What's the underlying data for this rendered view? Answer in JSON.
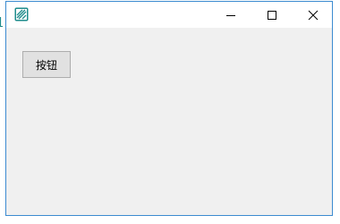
{
  "window": {
    "icon": "app-icon",
    "controls": {
      "minimize_icon": "minimize-icon",
      "maximize_icon": "maximize-icon",
      "close_icon": "close-icon"
    },
    "border_color": "#3c8bd0",
    "client_color": "#f0f0f0"
  },
  "content": {
    "button_label": "按钮"
  },
  "accent_color": "#1f8c8c"
}
